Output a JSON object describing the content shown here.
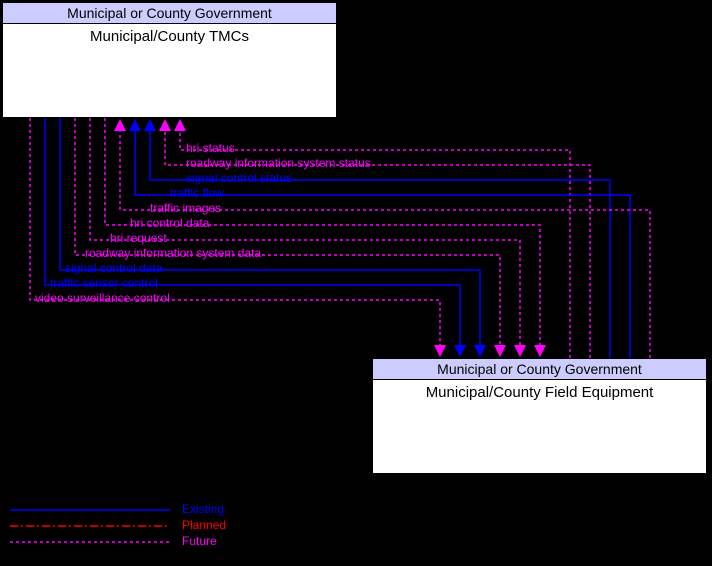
{
  "entity_top": {
    "header": "Municipal or County Government",
    "body": "Municipal/County TMCs"
  },
  "entity_bottom": {
    "header": "Municipal or County Government",
    "body": "Municipal/County Field Equipment"
  },
  "flows": {
    "hri_status": {
      "label": "hri status",
      "status": "future",
      "direction": "up"
    },
    "roadway_info_status": {
      "label": "roadway information system status",
      "status": "future",
      "direction": "up"
    },
    "signal_control_status": {
      "label": "signal control status",
      "status": "existing",
      "direction": "up"
    },
    "traffic_flow": {
      "label": "traffic flow",
      "status": "existing",
      "direction": "up"
    },
    "traffic_images": {
      "label": "traffic images",
      "status": "future",
      "direction": "up"
    },
    "hri_control_data": {
      "label": "hri control data",
      "status": "future",
      "direction": "down"
    },
    "hri_request": {
      "label": "hri request",
      "status": "future",
      "direction": "down"
    },
    "roadway_info_data": {
      "label": "roadway information system data",
      "status": "future",
      "direction": "down"
    },
    "signal_control_data": {
      "label": "signal control data",
      "status": "existing",
      "direction": "down"
    },
    "traffic_sensor_control": {
      "label": "traffic sensor control",
      "status": "existing",
      "direction": "down"
    },
    "video_surveillance_control": {
      "label": "video surveillance control",
      "status": "future",
      "direction": "down"
    }
  },
  "legend": {
    "existing": {
      "label": "Existing",
      "color": "#0000ff"
    },
    "planned": {
      "label": "Planned",
      "color": "#ff0000"
    },
    "future": {
      "label": "Future",
      "color": "#ff00ff"
    }
  }
}
